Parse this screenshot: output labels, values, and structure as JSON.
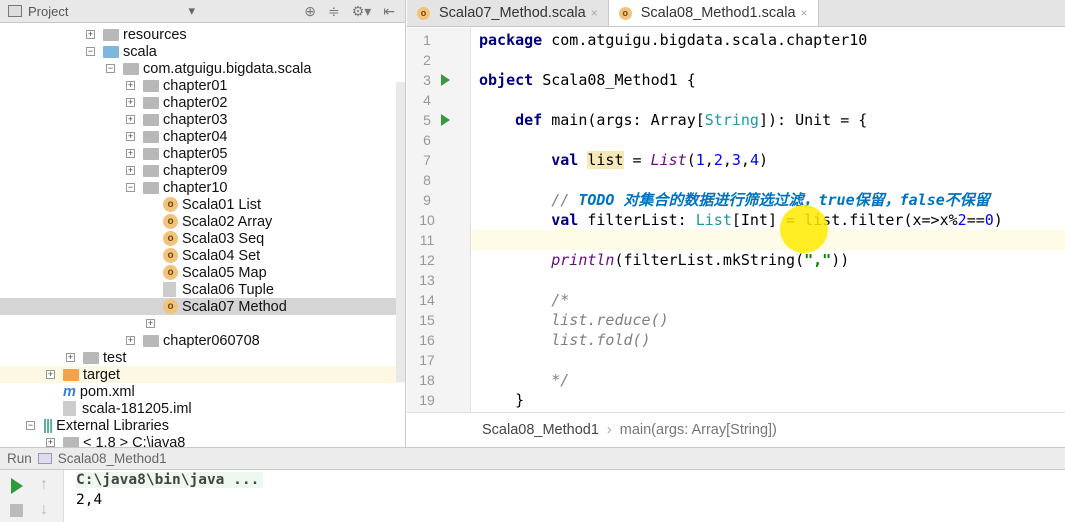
{
  "project": {
    "title": "Project",
    "tree": [
      {
        "label": "resources",
        "indent": 3,
        "exp": "+",
        "icon": "folder"
      },
      {
        "label": "scala",
        "indent": 3,
        "exp": "-",
        "icon": "folder-blue"
      },
      {
        "label": "com.atguigu.bigdata.scala",
        "indent": 4,
        "exp": "-",
        "icon": "folder"
      },
      {
        "label": "chapter01",
        "indent": 5,
        "exp": "+",
        "icon": "folder"
      },
      {
        "label": "chapter02",
        "indent": 5,
        "exp": "+",
        "icon": "folder"
      },
      {
        "label": "chapter03",
        "indent": 5,
        "exp": "+",
        "icon": "folder"
      },
      {
        "label": "chapter04",
        "indent": 5,
        "exp": "+",
        "icon": "folder"
      },
      {
        "label": "chapter05",
        "indent": 5,
        "exp": "+",
        "icon": "folder"
      },
      {
        "label": "chapter09",
        "indent": 5,
        "exp": "+",
        "icon": "folder"
      },
      {
        "label": "chapter10",
        "indent": 5,
        "exp": "-",
        "icon": "folder"
      },
      {
        "label": "Scala01 List",
        "indent": 6,
        "icon": "object"
      },
      {
        "label": "Scala02 Array",
        "indent": 6,
        "icon": "object"
      },
      {
        "label": "Scala03 Seq",
        "indent": 6,
        "icon": "object"
      },
      {
        "label": "Scala04 Set",
        "indent": 6,
        "icon": "object"
      },
      {
        "label": "Scala05 Map",
        "indent": 6,
        "icon": "object"
      },
      {
        "label": "Scala06 Tuple",
        "indent": 6,
        "icon": "file"
      },
      {
        "label": "Scala07 Method",
        "indent": 6,
        "icon": "object",
        "selected": true
      },
      {
        "label": "",
        "indent": 6,
        "exp": "+",
        "icon": "none"
      },
      {
        "label": "chapter060708",
        "indent": 5,
        "exp": "+",
        "icon": "folder"
      },
      {
        "label": "test",
        "indent": 2,
        "exp": "+",
        "icon": "folder"
      },
      {
        "label": "target",
        "indent": 1,
        "exp": "+",
        "icon": "folder-orange",
        "highlight": true
      },
      {
        "label": "pom.xml",
        "indent": 1,
        "icon": "maven"
      },
      {
        "label": "scala-181205.iml",
        "indent": 1,
        "icon": "file"
      },
      {
        "label": "External Libraries",
        "indent": 0,
        "exp": "-",
        "icon": "library"
      },
      {
        "label": "< 1.8 >  C:\\java8",
        "indent": 1,
        "exp": "+",
        "icon": "folder"
      }
    ]
  },
  "tabs": [
    {
      "label": "Scala07_Method.scala",
      "active": false
    },
    {
      "label": "Scala08_Method1.scala",
      "active": true
    }
  ],
  "editor": {
    "current_line": 11,
    "run_lines": [
      3,
      5
    ],
    "lines": [
      [
        [
          "package",
          "kw"
        ],
        [
          " com.atguigu.bigdata.scala.chapter10",
          ""
        ]
      ],
      [],
      [
        [
          "object",
          "kw"
        ],
        [
          " Scala08_Method1 {",
          ""
        ]
      ],
      [],
      [
        [
          "    ",
          ""
        ],
        [
          "def",
          "kw"
        ],
        [
          " main(args: Array[",
          ""
        ],
        [
          "String",
          "ty"
        ],
        [
          "]): Unit = {",
          ""
        ]
      ],
      [],
      [
        [
          "        ",
          ""
        ],
        [
          "val",
          "kw"
        ],
        [
          " ",
          ""
        ],
        [
          "list",
          "mark"
        ],
        [
          " = ",
          ""
        ],
        [
          "List",
          "it"
        ],
        [
          "(",
          ""
        ],
        [
          "1",
          "num"
        ],
        [
          ",",
          ""
        ],
        [
          "2",
          "num"
        ],
        [
          ",",
          ""
        ],
        [
          "3",
          "num"
        ],
        [
          ",",
          ""
        ],
        [
          "4",
          "num"
        ],
        [
          ")",
          ""
        ]
      ],
      [],
      [
        [
          "        ",
          ""
        ],
        [
          "// ",
          "cm"
        ],
        [
          "TODO 对集合的数据进行筛选过滤，true保留，false不保留",
          "todo"
        ]
      ],
      [
        [
          "        ",
          ""
        ],
        [
          "val",
          "kw"
        ],
        [
          " filterList: ",
          ""
        ],
        [
          "List",
          "ty"
        ],
        [
          "[Int] = list.filter(x=>x%",
          ""
        ],
        [
          "2",
          "num"
        ],
        [
          "==",
          ""
        ],
        [
          "0",
          "num"
        ],
        [
          ")",
          ""
        ]
      ],
      [],
      [
        [
          "        ",
          ""
        ],
        [
          "println",
          "it"
        ],
        [
          "(filterList.mkString(",
          ""
        ],
        [
          "\",\"",
          "str"
        ],
        [
          "))",
          ""
        ]
      ],
      [],
      [
        [
          "        ",
          ""
        ],
        [
          "/*",
          "cm"
        ]
      ],
      [
        [
          "        ",
          ""
        ],
        [
          "list.reduce()",
          "cm"
        ]
      ],
      [
        [
          "        ",
          ""
        ],
        [
          "list.fold()",
          "cm"
        ]
      ],
      [],
      [
        [
          "        ",
          ""
        ],
        [
          "*/",
          "cm"
        ]
      ],
      [
        [
          "    }",
          ""
        ]
      ]
    ]
  },
  "breadcrumb": [
    "Scala08_Method1",
    "main(args: Array[String])"
  ],
  "run": {
    "label": "Run",
    "config": "Scala08_Method1",
    "output": [
      "C:\\java8\\bin\\java ...",
      "2,4"
    ]
  }
}
